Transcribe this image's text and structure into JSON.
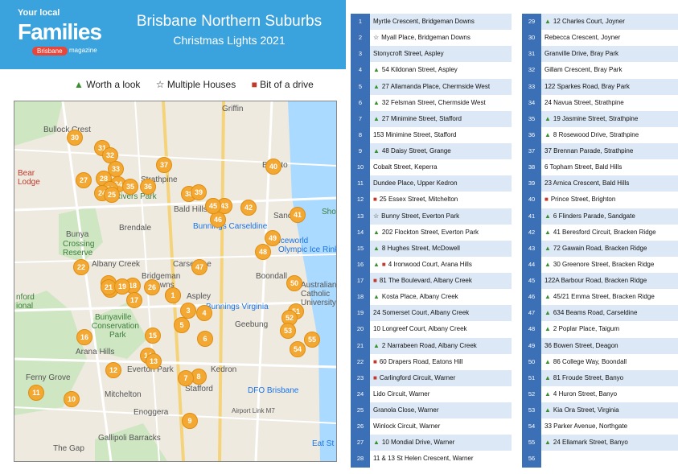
{
  "header": {
    "logo_small": "Your local",
    "logo_big": "Families",
    "logo_city": "Brisbane",
    "logo_mag": "magazine",
    "title": "Brisbane Northern Suburbs",
    "subtitle": "Christmas Lights 2021"
  },
  "legend": {
    "worth": "Worth a look",
    "multiple": "Multiple Houses",
    "drive": "Bit of a drive"
  },
  "map": {
    "labels": [
      {
        "id": "griffin",
        "text": "Griffin",
        "cls": ""
      },
      {
        "id": "bullock",
        "text": "Bullock Crest",
        "cls": ""
      },
      {
        "id": "strathpine",
        "text": "Strathpine",
        "cls": ""
      },
      {
        "id": "brighton",
        "text": "Brighto",
        "cls": ""
      },
      {
        "id": "bear",
        "text": "Bear",
        "cls": "red"
      },
      {
        "id": "lodge",
        "text": "Lodge",
        "cls": "red"
      },
      {
        "id": "riverspark",
        "text": "Rivers Park",
        "cls": "green"
      },
      {
        "id": "baldhills",
        "text": "Bald Hills",
        "cls": ""
      },
      {
        "id": "sandgate",
        "text": "Sanc",
        "cls": ""
      },
      {
        "id": "sho",
        "text": "Sho",
        "cls": "green"
      },
      {
        "id": "brendale",
        "text": "Brendale",
        "cls": ""
      },
      {
        "id": "bunnings1",
        "text": "Bunnings Carseldine",
        "cls": "blue"
      },
      {
        "id": "bunya",
        "text": "Bunya",
        "cls": ""
      },
      {
        "id": "crossing",
        "text": "Crossing",
        "cls": "green"
      },
      {
        "id": "reserve",
        "text": "Reserve",
        "cls": "green"
      },
      {
        "id": "iceworld",
        "text": "Iceworld",
        "cls": "blue"
      },
      {
        "id": "olympic",
        "text": "Olympic Ice Rink",
        "cls": "blue"
      },
      {
        "id": "albanycreek",
        "text": "Albany Creek",
        "cls": ""
      },
      {
        "id": "carseldine",
        "text": "Carseldine",
        "cls": ""
      },
      {
        "id": "boondall",
        "text": "Boondall",
        "cls": ""
      },
      {
        "id": "bridgeman",
        "text": "Bridgeman",
        "cls": ""
      },
      {
        "id": "downs",
        "text": "Downs",
        "cls": ""
      },
      {
        "id": "australian",
        "text": "Australian",
        "cls": ""
      },
      {
        "id": "catholic",
        "text": "Catholic",
        "cls": ""
      },
      {
        "id": "university",
        "text": "University",
        "cls": ""
      },
      {
        "id": "nford",
        "text": "nford",
        "cls": "green"
      },
      {
        "id": "ional",
        "text": "ional",
        "cls": "green"
      },
      {
        "id": "aspley",
        "text": "Aspley",
        "cls": ""
      },
      {
        "id": "bunnings2",
        "text": "Bunnings Virginia",
        "cls": "blue"
      },
      {
        "id": "bunyaville",
        "text": "Bunyaville",
        "cls": "green"
      },
      {
        "id": "conservation",
        "text": "Conservation",
        "cls": "green"
      },
      {
        "id": "park",
        "text": "Park",
        "cls": "green"
      },
      {
        "id": "geebung",
        "text": "Geebung",
        "cls": ""
      },
      {
        "id": "aranahills",
        "text": "Arana Hills",
        "cls": ""
      },
      {
        "id": "evertonpark",
        "text": "Everton Park",
        "cls": ""
      },
      {
        "id": "kedron",
        "text": "Kedron",
        "cls": ""
      },
      {
        "id": "fernygrove",
        "text": "Ferny Grove",
        "cls": ""
      },
      {
        "id": "stafford",
        "text": "Stafford",
        "cls": ""
      },
      {
        "id": "mitchelton",
        "text": "Mitchelton",
        "cls": ""
      },
      {
        "id": "dfo",
        "text": "DFO Brisbane",
        "cls": "blue"
      },
      {
        "id": "enoggera",
        "text": "Enoggera",
        "cls": ""
      },
      {
        "id": "gallipoli",
        "text": "Gallipoli Barracks",
        "cls": ""
      },
      {
        "id": "thegap",
        "text": "The Gap",
        "cls": ""
      },
      {
        "id": "airport",
        "text": "Airport Link M7",
        "cls": ""
      },
      {
        "id": "eastst",
        "text": "Eat St",
        "cls": "blue"
      }
    ],
    "markers": [
      "30",
      "31",
      "32",
      "33",
      "37",
      "40",
      "27",
      "28",
      "34",
      "29",
      "35",
      "36",
      "38",
      "39",
      "24",
      "25",
      "26",
      "44",
      "43",
      "42",
      "41",
      "46",
      "49",
      "48",
      "22",
      "47",
      "20",
      "23",
      "18",
      "50",
      "21",
      "19",
      "2",
      "17",
      "3",
      "4",
      "5",
      "16",
      "15",
      "14",
      "13",
      "12",
      "8",
      "7",
      "11",
      "10",
      "9",
      "51",
      "52",
      "53",
      "54",
      "55",
      "6",
      "45",
      "1"
    ]
  },
  "table": {
    "col1": [
      {
        "n": "1",
        "icon": "",
        "text": "Myrtle Crescent, Bridgeman Downs"
      },
      {
        "n": "2",
        "icon": "star",
        "text": "Myall Place, Bridgeman Downs"
      },
      {
        "n": "3",
        "icon": "",
        "text": "Stonycroft Street, Aspley"
      },
      {
        "n": "4",
        "icon": "tree",
        "text": "54 Kildonan Street, Aspley"
      },
      {
        "n": "5",
        "icon": "tree",
        "text": "27 Allamanda Place, Chermside West"
      },
      {
        "n": "6",
        "icon": "tree",
        "text": "32 Felsman Street, Chermside West"
      },
      {
        "n": "7",
        "icon": "tree",
        "text": "27 Minimine Street, Stafford"
      },
      {
        "n": "8",
        "icon": "",
        "text": "153 Minimine Street, Stafford"
      },
      {
        "n": "9",
        "icon": "tree",
        "text": "48 Daisy Street, Grange"
      },
      {
        "n": "10",
        "icon": "",
        "text": "Cobalt Street, Keperra"
      },
      {
        "n": "11",
        "icon": "",
        "text": "Dundee Place, Upper Kedron"
      },
      {
        "n": "12",
        "icon": "car",
        "text": "25 Essex Street, Mitchelton"
      },
      {
        "n": "13",
        "icon": "star",
        "text": "Bunny Street, Everton Park"
      },
      {
        "n": "14",
        "icon": "tree",
        "text": "202 Flockton Street, Everton Park"
      },
      {
        "n": "15",
        "icon": "tree",
        "text": "8 Hughes Street, McDowell"
      },
      {
        "n": "16",
        "icon": "treecar",
        "text": "4 Ironwood Court, Arana Hills"
      },
      {
        "n": "17",
        "icon": "car",
        "text": "81 The Boulevard, Albany Creek"
      },
      {
        "n": "18",
        "icon": "tree",
        "text": "Kosta Place, Albany Creek"
      },
      {
        "n": "19",
        "icon": "",
        "text": "24 Somerset Court, Albany Creek"
      },
      {
        "n": "20",
        "icon": "",
        "text": "10 Longreef Court, Albany Creek"
      },
      {
        "n": "21",
        "icon": "tree",
        "text": "2 Narrabeen Road, Albany Creek"
      },
      {
        "n": "22",
        "icon": "car",
        "text": "60 Drapers Road, Eatons Hill"
      },
      {
        "n": "23",
        "icon": "car",
        "text": "Carlingford Circuit, Warner"
      },
      {
        "n": "24",
        "icon": "",
        "text": "Lido Circuit, Warner"
      },
      {
        "n": "25",
        "icon": "",
        "text": "Granola Close, Warner"
      },
      {
        "n": "26",
        "icon": "",
        "text": "Winlock Circuit, Warner"
      },
      {
        "n": "27",
        "icon": "tree",
        "text": "10 Mondial Drive, Warner"
      },
      {
        "n": "28",
        "icon": "",
        "text": "11 & 13 St Helen Crescent, Warner"
      }
    ],
    "col2": [
      {
        "n": "29",
        "icon": "tree",
        "text": "12 Charles Court, Joyner"
      },
      {
        "n": "30",
        "icon": "",
        "text": "Rebecca Crescent, Joyner"
      },
      {
        "n": "31",
        "icon": "",
        "text": "Granville Drive, Bray Park"
      },
      {
        "n": "32",
        "icon": "",
        "text": "Gillam Crescent, Bray Park"
      },
      {
        "n": "33",
        "icon": "",
        "text": "122 Sparkes Road, Bray Park"
      },
      {
        "n": "34",
        "icon": "",
        "text": "24 Navua Street, Strathpine"
      },
      {
        "n": "35",
        "icon": "tree",
        "text": "19 Jasmine Street, Strathpine"
      },
      {
        "n": "36",
        "icon": "tree",
        "text": "8 Rosewood Drive, Strathpine"
      },
      {
        "n": "37",
        "icon": "",
        "text": "37 Brennan Parade, Strathpine"
      },
      {
        "n": "38",
        "icon": "",
        "text": "6 Topham Street, Bald Hills"
      },
      {
        "n": "39",
        "icon": "",
        "text": "23 Arnica Crescent, Bald Hills"
      },
      {
        "n": "40",
        "icon": "car",
        "text": "Prince Street, Brighton"
      },
      {
        "n": "41",
        "icon": "tree",
        "text": "6 Flinders Parade, Sandgate"
      },
      {
        "n": "42",
        "icon": "tree",
        "text": "41 Beresford Circuit, Bracken Ridge"
      },
      {
        "n": "43",
        "icon": "tree",
        "text": "72 Gawain Road, Bracken Ridge"
      },
      {
        "n": "44",
        "icon": "tree",
        "text": "30 Greenore Street, Bracken Ridge"
      },
      {
        "n": "45",
        "icon": "",
        "text": "122A Barbour Road, Bracken Ridge"
      },
      {
        "n": "46",
        "icon": "tree",
        "text": "45/21 Emma Street, Bracken Ridge"
      },
      {
        "n": "47",
        "icon": "tree",
        "text": "634 Beams Road, Carseldine"
      },
      {
        "n": "48",
        "icon": "tree",
        "text": "2 Poplar Place, Taigum"
      },
      {
        "n": "49",
        "icon": "",
        "text": "36 Bowen Street, Deagon"
      },
      {
        "n": "50",
        "icon": "tree",
        "text": "86 College Way, Boondall"
      },
      {
        "n": "51",
        "icon": "tree",
        "text": "81 Froude Street, Banyo"
      },
      {
        "n": "52",
        "icon": "tree",
        "text": "4 Huron Street, Banyo"
      },
      {
        "n": "53",
        "icon": "tree",
        "text": "Kia Ora Street, Virginia"
      },
      {
        "n": "54",
        "icon": "",
        "text": "33 Parker Avenue, Northgate"
      },
      {
        "n": "55",
        "icon": "tree",
        "text": "24 Ellamark Street, Banyo"
      },
      {
        "n": "56",
        "icon": "",
        "text": ""
      }
    ]
  }
}
